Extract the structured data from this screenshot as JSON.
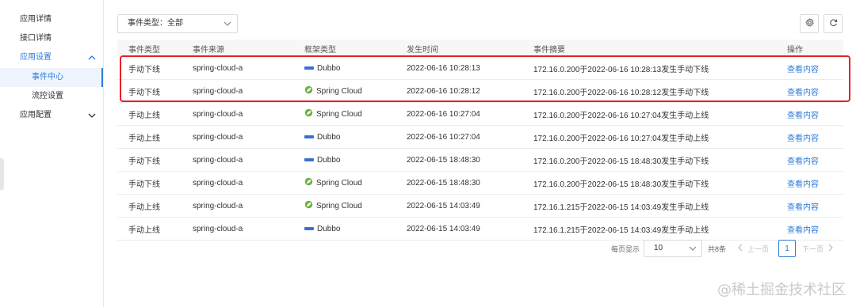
{
  "sidebar": {
    "items": [
      {
        "label": "应用详情"
      },
      {
        "label": "接口详情"
      },
      {
        "label": "应用设置"
      },
      {
        "label": "事件中心"
      },
      {
        "label": "流控设置"
      },
      {
        "label": "应用配置"
      }
    ]
  },
  "filter": {
    "event_type_label": "事件类型：全部"
  },
  "toolbar": {
    "settings_icon": "gear-icon",
    "refresh_icon": "refresh-icon"
  },
  "table": {
    "headers": [
      "事件类型",
      "事件来源",
      "框架类型",
      "发生时间",
      "事件摘要",
      "操作"
    ],
    "rows": [
      {
        "type": "手动下线",
        "source": "spring-cloud-a",
        "framework": "Dubbo",
        "time": "2022-06-16 10:28:13",
        "summary": "172.16.0.200于2022-06-16 10:28:13发生手动下线",
        "action": "查看内容"
      },
      {
        "type": "手动下线",
        "source": "spring-cloud-a",
        "framework": "Spring Cloud",
        "time": "2022-06-16 10:28:12",
        "summary": "172.16.0.200于2022-06-16 10:28:12发生手动下线",
        "action": "查看内容"
      },
      {
        "type": "手动上线",
        "source": "spring-cloud-a",
        "framework": "Spring Cloud",
        "time": "2022-06-16 10:27:04",
        "summary": "172.16.0.200于2022-06-16 10:27:04发生手动上线",
        "action": "查看内容"
      },
      {
        "type": "手动上线",
        "source": "spring-cloud-a",
        "framework": "Dubbo",
        "time": "2022-06-16 10:27:04",
        "summary": "172.16.0.200于2022-06-16 10:27:04发生手动上线",
        "action": "查看内容"
      },
      {
        "type": "手动下线",
        "source": "spring-cloud-a",
        "framework": "Dubbo",
        "time": "2022-06-15 18:48:30",
        "summary": "172.16.0.200于2022-06-15 18:48:30发生手动下线",
        "action": "查看内容"
      },
      {
        "type": "手动下线",
        "source": "spring-cloud-a",
        "framework": "Spring Cloud",
        "time": "2022-06-15 18:48:30",
        "summary": "172.16.0.200于2022-06-15 18:48:30发生手动下线",
        "action": "查看内容"
      },
      {
        "type": "手动上线",
        "source": "spring-cloud-a",
        "framework": "Spring Cloud",
        "time": "2022-06-15 14:03:49",
        "summary": "172.16.1.215于2022-06-15 14:03:49发生手动上线",
        "action": "查看内容"
      },
      {
        "type": "手动上线",
        "source": "spring-cloud-a",
        "framework": "Dubbo",
        "time": "2022-06-15 14:03:49",
        "summary": "172.16.1.215于2022-06-15 14:03:49发生手动上线",
        "action": "查看内容"
      }
    ]
  },
  "pagination": {
    "page_size_label": "每页显示",
    "page_size": "10",
    "total": "共8条",
    "prev": "上一页",
    "current_page": "1",
    "next": "下一页"
  },
  "watermark": "@稀土掘金技术社区",
  "colors": {
    "accent": "#2d7bd9",
    "highlight": "#e8202a"
  }
}
